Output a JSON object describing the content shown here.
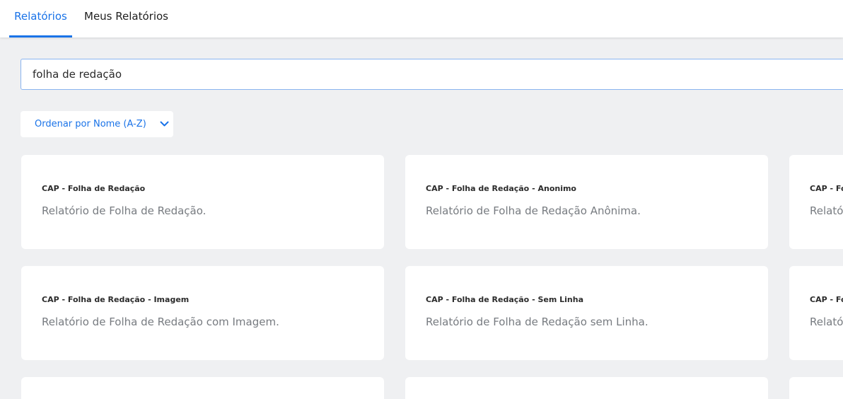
{
  "tabs": [
    {
      "label": "Relatórios",
      "active": true
    },
    {
      "label": "Meus Relatórios",
      "active": false
    }
  ],
  "search": {
    "value": "folha de redação",
    "placeholder": ""
  },
  "sort": {
    "label": "Ordenar por Nome (A-Z)",
    "icon": "chevron-down-icon"
  },
  "cards": [
    {
      "title": "CAP - Folha de Redação",
      "description": "Relatório de Folha de Redação."
    },
    {
      "title": "CAP - Folha de Redação - Anonimo",
      "description": "Relatório de Folha de Redação Anônima."
    },
    {
      "title": "CAP - Fo",
      "description": "Relató"
    },
    {
      "title": "CAP - Folha de Redação - Imagem",
      "description": "Relatório de Folha de Redação com Imagem."
    },
    {
      "title": "CAP - Folha de Redação - Sem Linha",
      "description": "Relatório de Folha de Redação sem Linha."
    },
    {
      "title": "CAP - Fo",
      "description": "Relató"
    }
  ],
  "colors": {
    "accent": "#1a73e8",
    "background": "#eff0f2",
    "card": "#ffffff",
    "description_text": "#777b80"
  }
}
